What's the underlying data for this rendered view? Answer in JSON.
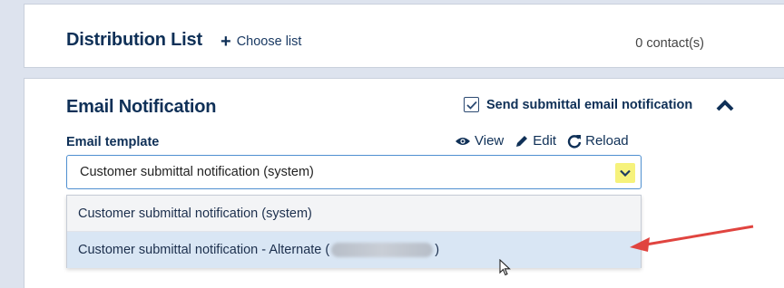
{
  "distribution": {
    "title": "Distribution List",
    "choose_list": "Choose list",
    "contacts": "0 contact(s)"
  },
  "email": {
    "title": "Email Notification",
    "send_label": "Send submittal email notification",
    "send_checked": true,
    "template_label": "Email template",
    "actions": {
      "view": "View",
      "edit": "Edit",
      "reload": "Reload"
    },
    "selected_value": "Customer submittal notification (system)",
    "options": [
      {
        "label": "Customer submittal notification (system)"
      },
      {
        "label_prefix": "Customer submittal notification - Alternate (",
        "label_suffix": ")"
      }
    ]
  },
  "colors": {
    "heading": "#0f3057",
    "highlight": "#f6f27c",
    "option_hover": "#d9e6f4",
    "annotation_arrow": "#e0443f"
  }
}
